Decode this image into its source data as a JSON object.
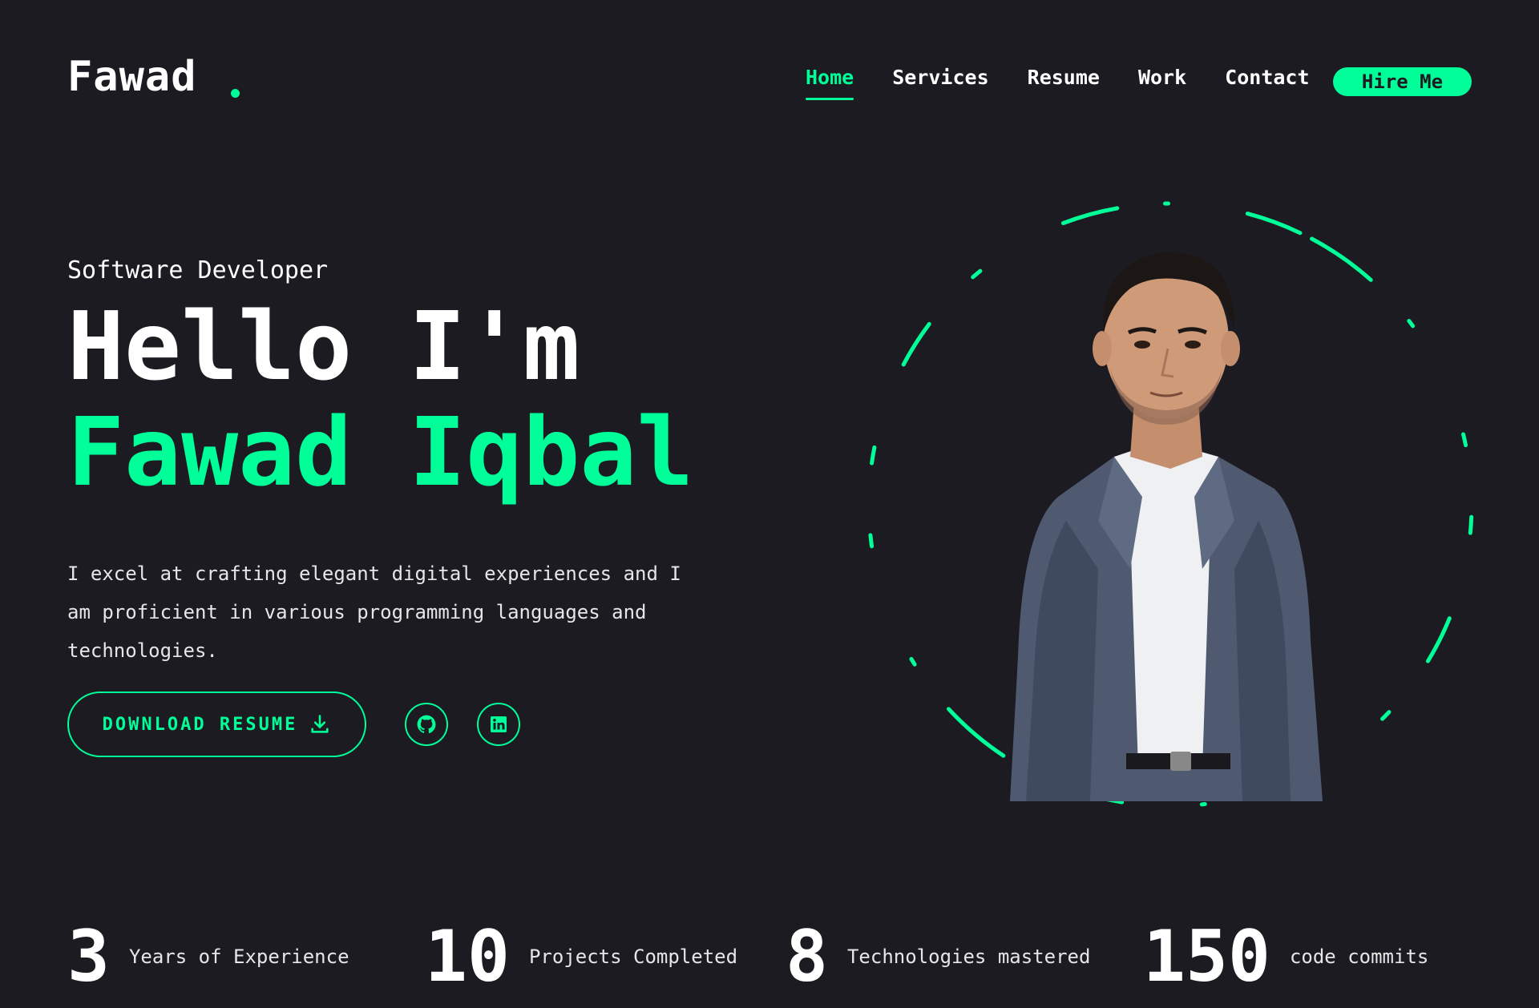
{
  "header": {
    "logo": "Fawad",
    "nav": [
      "Home",
      "Services",
      "Resume",
      "Work",
      "Contact"
    ],
    "active_nav": "Home",
    "hire_label": "Hire Me"
  },
  "hero": {
    "role": "Software Developer",
    "greeting": "Hello I'm",
    "name": "Fawad Iqbal",
    "intro": "I excel at crafting elegant digital experiences and I am proficient in various programming languages and technologies.",
    "resume_label": "DOWNLOAD RESUME",
    "socials": [
      "github-icon",
      "linkedin-icon"
    ]
  },
  "stats": [
    {
      "value": "3",
      "label": "Years of Experience"
    },
    {
      "value": "10",
      "label": "Projects Completed"
    },
    {
      "value": "8",
      "label": "Technologies mastered"
    },
    {
      "value": "150",
      "label": "code commits"
    }
  ],
  "colors": {
    "accent": "#00ff99",
    "background": "#1c1b22",
    "text": "#ffffff"
  }
}
